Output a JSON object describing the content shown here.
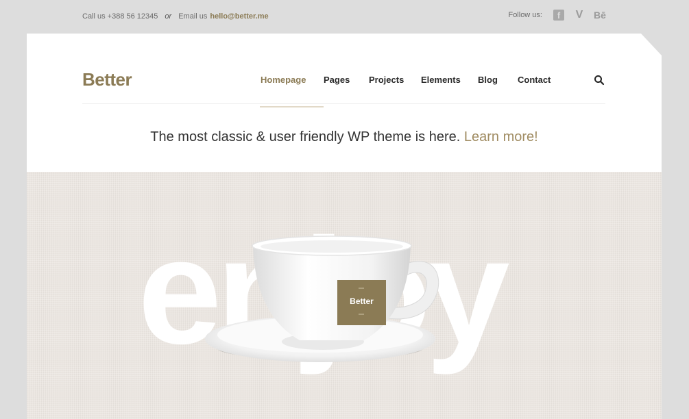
{
  "topbar": {
    "call_text": "Call us +388 56 12345",
    "or_text": "or",
    "email_label": "Email us",
    "email": "hello@better.me",
    "follow_label": "Follow us:",
    "social": [
      {
        "name": "facebook-icon",
        "glyph": "f"
      },
      {
        "name": "vimeo-icon",
        "glyph": "V"
      },
      {
        "name": "behance-icon",
        "glyph": "Bē"
      }
    ]
  },
  "header": {
    "logo": "Better",
    "nav": [
      "Homepage",
      "Pages",
      "Projects",
      "Elements",
      "Blog",
      "Contact"
    ],
    "active_nav": "Homepage",
    "search_icon": "search-icon"
  },
  "tagline": {
    "text": "The most classic & user friendly WP theme is here.",
    "link": "Learn more!"
  },
  "hero": {
    "big_word": "enjoy",
    "cup_label": "Better"
  },
  "colors": {
    "accent": "#8b7b55",
    "background": "#dddddd",
    "hero_bg": "#ebe6e1"
  }
}
